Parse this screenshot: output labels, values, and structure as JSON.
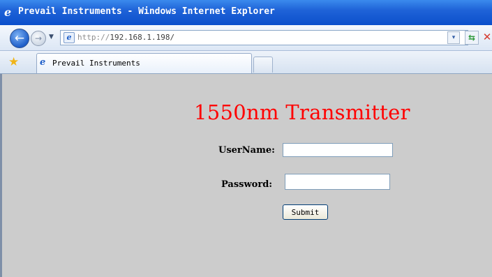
{
  "window": {
    "title": "Prevail Instruments - Windows Internet Explorer",
    "title_icon": "ie-logo-icon"
  },
  "nav": {
    "back_glyph": "←",
    "forward_glyph": "→",
    "history_dropdown_glyph": "▼",
    "address_protocol": "http://",
    "address_host": "192.168.1.198/",
    "address_dropdown_glyph": "▾",
    "refresh_glyph": "⇆",
    "stop_glyph": "✕"
  },
  "tabs": {
    "favorites_glyph": "★",
    "active_tab_label": "Prevail Instruments"
  },
  "page": {
    "heading": "1550nm Transmitter",
    "username_label": "UserName:",
    "username_value": "",
    "password_label": "Password:",
    "password_value": "",
    "submit_label": "Submit"
  },
  "colors": {
    "heading": "#ff0000",
    "content_background": "#cccccc",
    "titlebar": "#1f63d8"
  }
}
